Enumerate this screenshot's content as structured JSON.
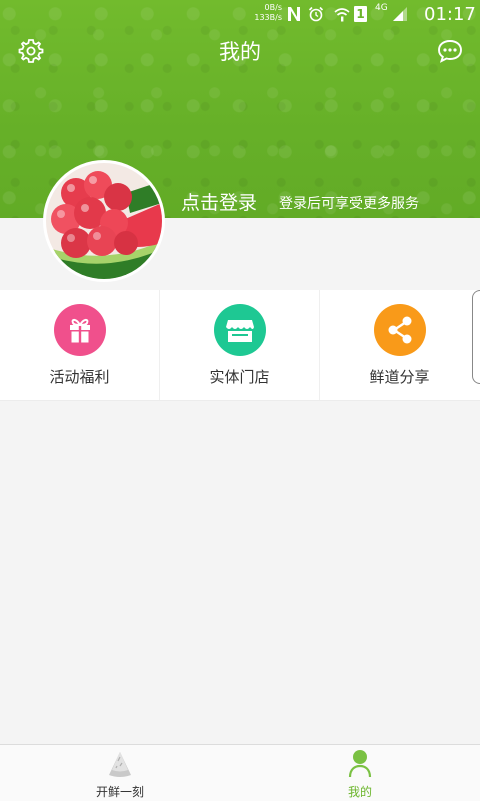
{
  "status_bar": {
    "net_up": "0B/s",
    "net_down": "133B/s",
    "time": "01:17",
    "network_type": "4G",
    "sim_slot": "1",
    "icons": [
      "nfc-icon",
      "alarm-icon",
      "wifi-icon",
      "sim-icon",
      "signal-icon"
    ]
  },
  "header": {
    "title": "我的",
    "settings_icon": "gear-icon",
    "message_icon": "chat-bubble-icon",
    "background_color": "#6bb52b"
  },
  "profile": {
    "login_label": "点击登录",
    "login_hint": "登录后可享受更多服务",
    "avatar": "watermelon-avatar"
  },
  "menu": [
    {
      "label": "活动福利",
      "icon": "gift-icon",
      "color": "#f0508c"
    },
    {
      "label": "实体门店",
      "icon": "store-icon",
      "color": "#1ec893"
    },
    {
      "label": "鲜道分享",
      "icon": "share-icon",
      "color": "#f99a19"
    }
  ],
  "tabbar": {
    "tabs": [
      {
        "label": "开鲜一刻",
        "icon": "watermelon-slice-icon",
        "active": false
      },
      {
        "label": "我的",
        "icon": "user-icon",
        "active": true
      }
    ],
    "active_color": "#6bb52b",
    "inactive_color": "#333333"
  }
}
